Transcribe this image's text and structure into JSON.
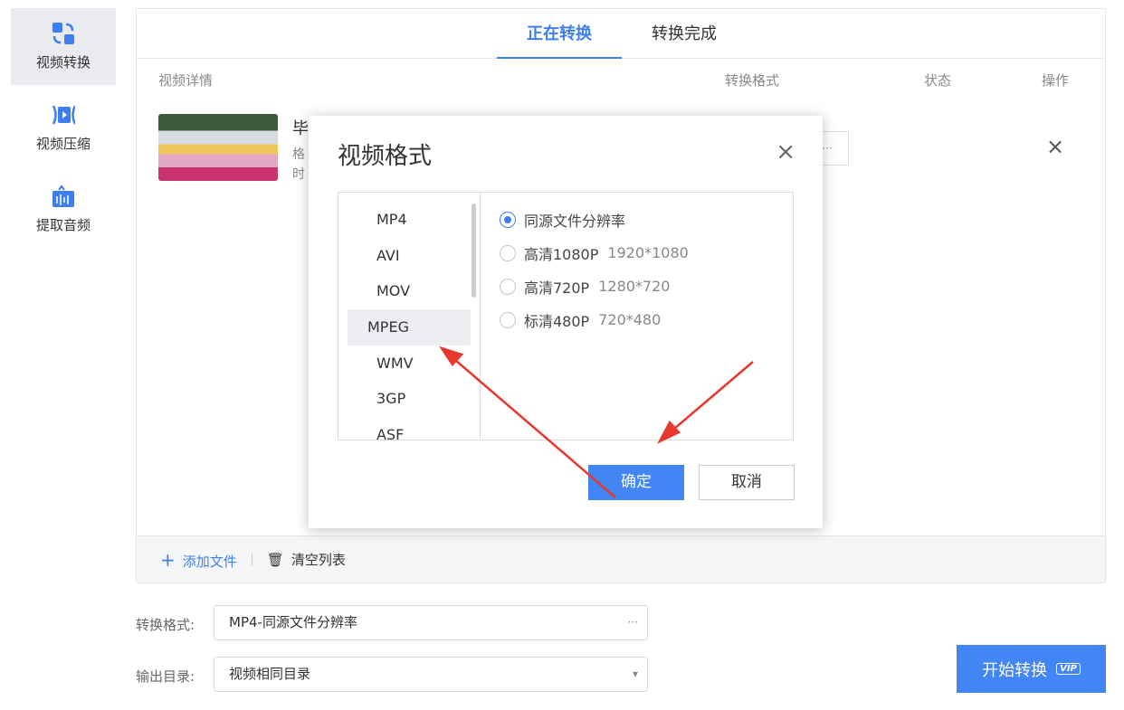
{
  "sidebar": {
    "items": [
      {
        "label": "视频转换"
      },
      {
        "label": "视频压缩"
      },
      {
        "label": "提取音频"
      }
    ]
  },
  "tabs": [
    {
      "label": "正在转换"
    },
    {
      "label": "转换完成"
    }
  ],
  "columns": {
    "details": "视频详情",
    "format": "转换格式",
    "status": "状态",
    "action": "操作"
  },
  "row": {
    "title": "毕",
    "line1": "格",
    "line2": "时",
    "more": "···",
    "remove": "×"
  },
  "footer": {
    "add": "添加文件",
    "clear": "清空列表"
  },
  "settings": {
    "format_label": "转换格式:",
    "format_value": "MP4-同源文件分辨率",
    "output_label": "输出目录:",
    "output_value": "视频相同目录",
    "more": "···",
    "caret": "▾"
  },
  "start": {
    "label": "开始转换",
    "badge": "VIP"
  },
  "dialog": {
    "title": "视频格式",
    "close": "×",
    "formats": [
      "MP4",
      "AVI",
      "MOV",
      "MPEG",
      "WMV",
      "3GP",
      "ASF"
    ],
    "selected_format": "MPEG",
    "options": [
      {
        "label": "同源文件分辨率",
        "res": "",
        "checked": true
      },
      {
        "label": "高清1080P",
        "res": "1920*1080",
        "checked": false
      },
      {
        "label": "高清720P",
        "res": "1280*720",
        "checked": false
      },
      {
        "label": "标清480P",
        "res": "720*480",
        "checked": false
      }
    ],
    "ok": "确定",
    "cancel": "取消"
  },
  "colors": {
    "accent": "#4285f4",
    "arrow": "#e8372c"
  }
}
